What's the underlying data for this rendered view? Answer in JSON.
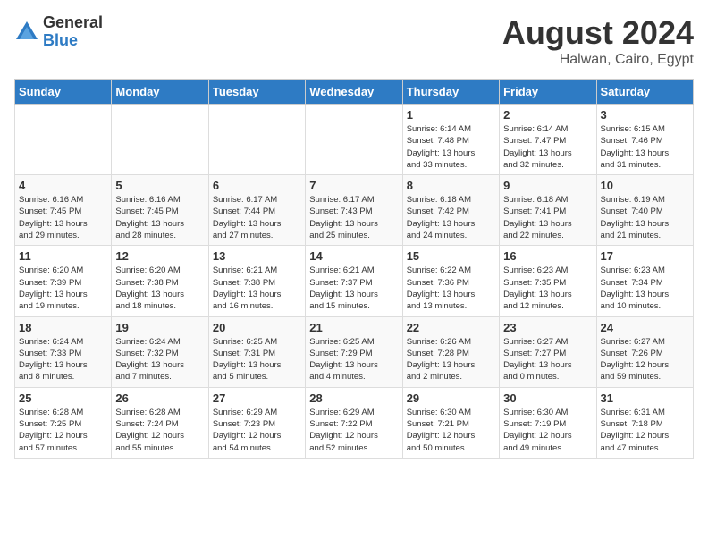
{
  "logo": {
    "general": "General",
    "blue": "Blue"
  },
  "title": "August 2024",
  "subtitle": "Halwan, Cairo, Egypt",
  "days_of_week": [
    "Sunday",
    "Monday",
    "Tuesday",
    "Wednesday",
    "Thursday",
    "Friday",
    "Saturday"
  ],
  "weeks": [
    [
      {
        "day": "",
        "info": ""
      },
      {
        "day": "",
        "info": ""
      },
      {
        "day": "",
        "info": ""
      },
      {
        "day": "",
        "info": ""
      },
      {
        "day": "1",
        "info": "Sunrise: 6:14 AM\nSunset: 7:48 PM\nDaylight: 13 hours\nand 33 minutes."
      },
      {
        "day": "2",
        "info": "Sunrise: 6:14 AM\nSunset: 7:47 PM\nDaylight: 13 hours\nand 32 minutes."
      },
      {
        "day": "3",
        "info": "Sunrise: 6:15 AM\nSunset: 7:46 PM\nDaylight: 13 hours\nand 31 minutes."
      }
    ],
    [
      {
        "day": "4",
        "info": "Sunrise: 6:16 AM\nSunset: 7:45 PM\nDaylight: 13 hours\nand 29 minutes."
      },
      {
        "day": "5",
        "info": "Sunrise: 6:16 AM\nSunset: 7:45 PM\nDaylight: 13 hours\nand 28 minutes."
      },
      {
        "day": "6",
        "info": "Sunrise: 6:17 AM\nSunset: 7:44 PM\nDaylight: 13 hours\nand 27 minutes."
      },
      {
        "day": "7",
        "info": "Sunrise: 6:17 AM\nSunset: 7:43 PM\nDaylight: 13 hours\nand 25 minutes."
      },
      {
        "day": "8",
        "info": "Sunrise: 6:18 AM\nSunset: 7:42 PM\nDaylight: 13 hours\nand 24 minutes."
      },
      {
        "day": "9",
        "info": "Sunrise: 6:18 AM\nSunset: 7:41 PM\nDaylight: 13 hours\nand 22 minutes."
      },
      {
        "day": "10",
        "info": "Sunrise: 6:19 AM\nSunset: 7:40 PM\nDaylight: 13 hours\nand 21 minutes."
      }
    ],
    [
      {
        "day": "11",
        "info": "Sunrise: 6:20 AM\nSunset: 7:39 PM\nDaylight: 13 hours\nand 19 minutes."
      },
      {
        "day": "12",
        "info": "Sunrise: 6:20 AM\nSunset: 7:38 PM\nDaylight: 13 hours\nand 18 minutes."
      },
      {
        "day": "13",
        "info": "Sunrise: 6:21 AM\nSunset: 7:38 PM\nDaylight: 13 hours\nand 16 minutes."
      },
      {
        "day": "14",
        "info": "Sunrise: 6:21 AM\nSunset: 7:37 PM\nDaylight: 13 hours\nand 15 minutes."
      },
      {
        "day": "15",
        "info": "Sunrise: 6:22 AM\nSunset: 7:36 PM\nDaylight: 13 hours\nand 13 minutes."
      },
      {
        "day": "16",
        "info": "Sunrise: 6:23 AM\nSunset: 7:35 PM\nDaylight: 13 hours\nand 12 minutes."
      },
      {
        "day": "17",
        "info": "Sunrise: 6:23 AM\nSunset: 7:34 PM\nDaylight: 13 hours\nand 10 minutes."
      }
    ],
    [
      {
        "day": "18",
        "info": "Sunrise: 6:24 AM\nSunset: 7:33 PM\nDaylight: 13 hours\nand 8 minutes."
      },
      {
        "day": "19",
        "info": "Sunrise: 6:24 AM\nSunset: 7:32 PM\nDaylight: 13 hours\nand 7 minutes."
      },
      {
        "day": "20",
        "info": "Sunrise: 6:25 AM\nSunset: 7:31 PM\nDaylight: 13 hours\nand 5 minutes."
      },
      {
        "day": "21",
        "info": "Sunrise: 6:25 AM\nSunset: 7:29 PM\nDaylight: 13 hours\nand 4 minutes."
      },
      {
        "day": "22",
        "info": "Sunrise: 6:26 AM\nSunset: 7:28 PM\nDaylight: 13 hours\nand 2 minutes."
      },
      {
        "day": "23",
        "info": "Sunrise: 6:27 AM\nSunset: 7:27 PM\nDaylight: 13 hours\nand 0 minutes."
      },
      {
        "day": "24",
        "info": "Sunrise: 6:27 AM\nSunset: 7:26 PM\nDaylight: 12 hours\nand 59 minutes."
      }
    ],
    [
      {
        "day": "25",
        "info": "Sunrise: 6:28 AM\nSunset: 7:25 PM\nDaylight: 12 hours\nand 57 minutes."
      },
      {
        "day": "26",
        "info": "Sunrise: 6:28 AM\nSunset: 7:24 PM\nDaylight: 12 hours\nand 55 minutes."
      },
      {
        "day": "27",
        "info": "Sunrise: 6:29 AM\nSunset: 7:23 PM\nDaylight: 12 hours\nand 54 minutes."
      },
      {
        "day": "28",
        "info": "Sunrise: 6:29 AM\nSunset: 7:22 PM\nDaylight: 12 hours\nand 52 minutes."
      },
      {
        "day": "29",
        "info": "Sunrise: 6:30 AM\nSunset: 7:21 PM\nDaylight: 12 hours\nand 50 minutes."
      },
      {
        "day": "30",
        "info": "Sunrise: 6:30 AM\nSunset: 7:19 PM\nDaylight: 12 hours\nand 49 minutes."
      },
      {
        "day": "31",
        "info": "Sunrise: 6:31 AM\nSunset: 7:18 PM\nDaylight: 12 hours\nand 47 minutes."
      }
    ]
  ]
}
